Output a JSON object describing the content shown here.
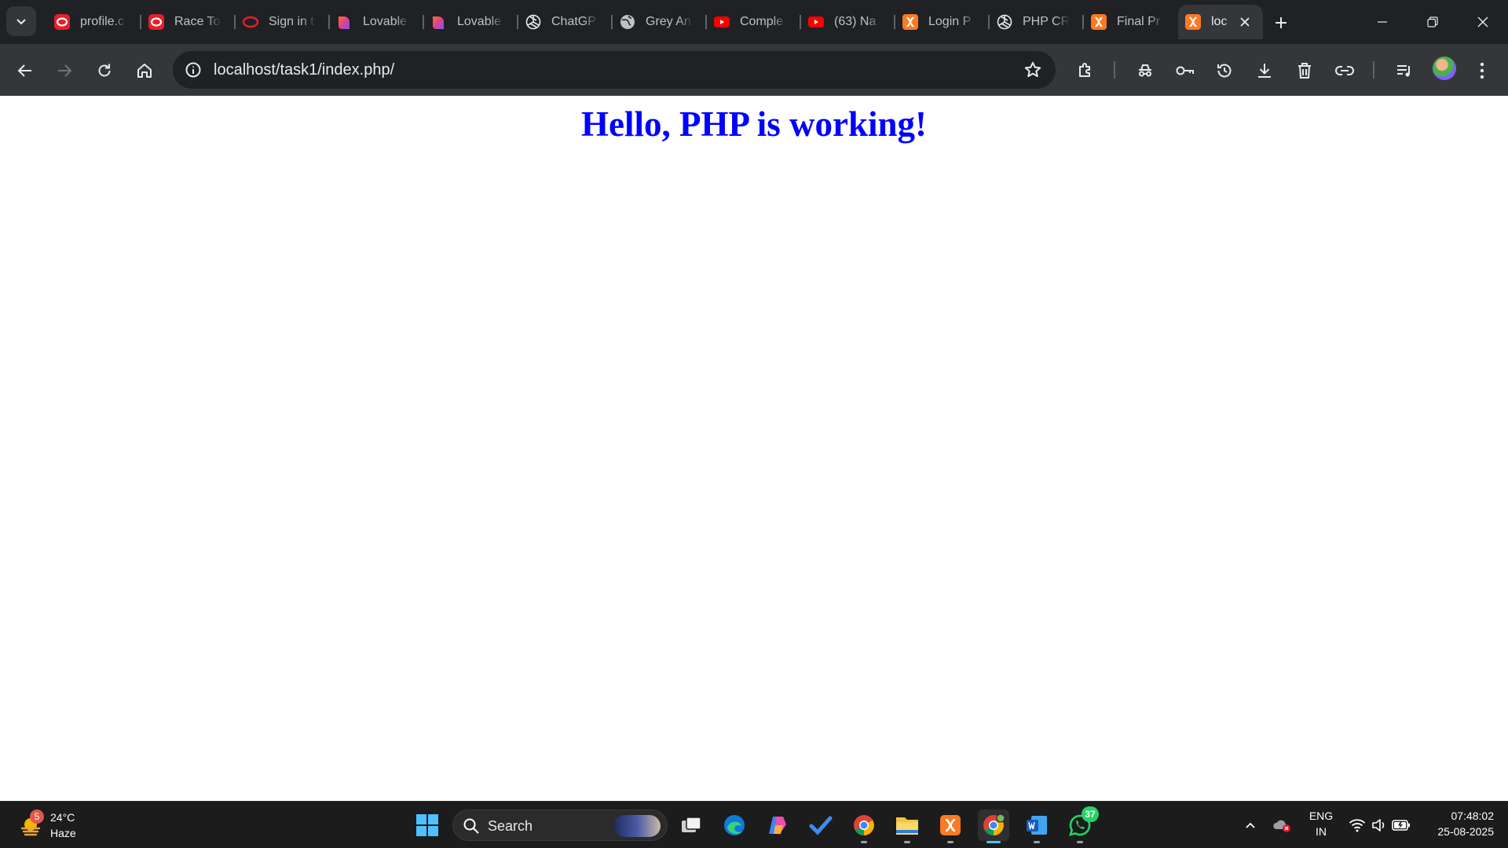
{
  "browser": {
    "tabs": [
      {
        "title": "profile.c",
        "icon": "opera-icon"
      },
      {
        "title": "Race To",
        "icon": "opera-icon"
      },
      {
        "title": "Sign in t",
        "icon": "opera-outline-icon"
      },
      {
        "title": "Lovable",
        "icon": "lovable-heart-icon"
      },
      {
        "title": "Lovable",
        "icon": "lovable-heart-icon"
      },
      {
        "title": "ChatGP",
        "icon": "openai-icon"
      },
      {
        "title": "Grey An",
        "icon": "globe-icon"
      },
      {
        "title": "Comple",
        "icon": "youtube-icon"
      },
      {
        "title": "(63) Na",
        "icon": "youtube-icon"
      },
      {
        "title": "Login P",
        "icon": "xampp-icon"
      },
      {
        "title": "PHP CR",
        "icon": "openai-icon"
      },
      {
        "title": "Final Pr",
        "icon": "xampp-icon"
      }
    ],
    "active_tab": {
      "title": "loc",
      "icon": "xampp-icon"
    },
    "address": "localhost/task1/index.php/",
    "colors": {
      "tabstrip": "#202124",
      "toolbar": "#35363a",
      "omnibox": "#202124"
    }
  },
  "page": {
    "heading": "Hello, PHP is working!",
    "heading_color": "#0000ff"
  },
  "taskbar": {
    "weather": {
      "badge": "5",
      "temp": "24°C",
      "condition": "Haze"
    },
    "search_label": "Search",
    "whatsapp_badge": "37",
    "lang_line1": "ENG",
    "lang_line2": "IN",
    "time": "07:48:02",
    "date": "25-08-2025"
  }
}
